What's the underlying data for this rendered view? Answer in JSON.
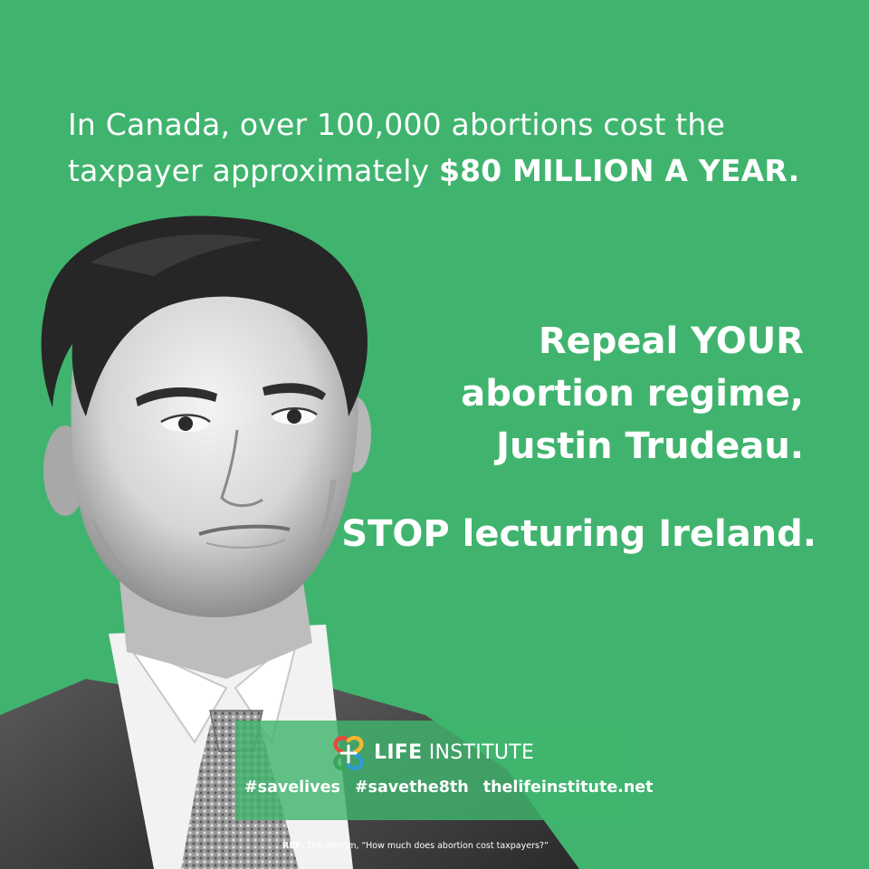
{
  "headline": {
    "line1": "In Canada, over 100,000 abortions cost the",
    "line2_prefix": "taxpayer approximately ",
    "line2_emphasis": "$80 MILLION A YEAR."
  },
  "call_to_action": {
    "line1_prefix": "Repeal ",
    "line1_emphasis": "YOUR",
    "line2": "abortion regime,",
    "line3": "Justin Trudeau."
  },
  "stop_line": "STOP lecturing Ireland.",
  "brand": {
    "name_bold": "LIFE",
    "name_rest": " INSTITUTE",
    "logo_icon": "life-institute-heart-cross-logo",
    "logo_colors": [
      "#e64a3c",
      "#f5b82e",
      "#2f9bd6",
      "#3aa655"
    ],
    "hashtags": [
      "#savelives",
      "#savethe8th",
      "thelifeinstitute.net"
    ]
  },
  "reference": {
    "label": "REF:",
    "text": " The Interim, “How much does abortion cost taxpayers?”"
  },
  "colors": {
    "background": "#40b46e",
    "text": "#ffffff"
  }
}
